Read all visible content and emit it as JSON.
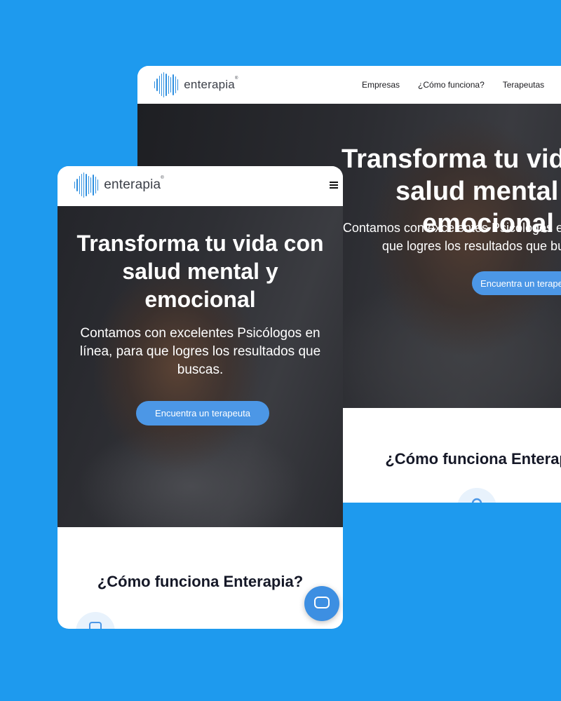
{
  "colors": {
    "background": "#1e9aee",
    "accent": "#4c97e6",
    "logo": "#2e8fe0",
    "heading": "#151827"
  },
  "brand": {
    "name": "enterapia",
    "mark": "®",
    "icon": "soundwave-logo-icon"
  },
  "desktop": {
    "menu": [
      "Empresas",
      "¿Cómo funciona?",
      "Terapeutas"
    ],
    "hero": {
      "title": "Transforma tu vida con salud mental y emocional",
      "subtitle": "Contamos con excelentes Psicólogos en línea, para que logres los resultados que buscas.",
      "cta": "Encuentra un terapeuta"
    },
    "section_title": "¿Cómo funciona Enterapia?",
    "step_icon": "user-icon"
  },
  "mobile": {
    "menu_icon": "hamburger-menu-icon",
    "hero": {
      "title": "Transforma tu vida con salud mental y emocional",
      "subtitle": "Contamos con excelentes Psicólogos en línea, para que logres los resultados que buscas.",
      "cta": "Encuentra un terapeuta"
    },
    "section_title": "¿Cómo funciona Enterapia?",
    "step_icon": "document-icon",
    "chat_icon": "chat-bubble-icon"
  }
}
